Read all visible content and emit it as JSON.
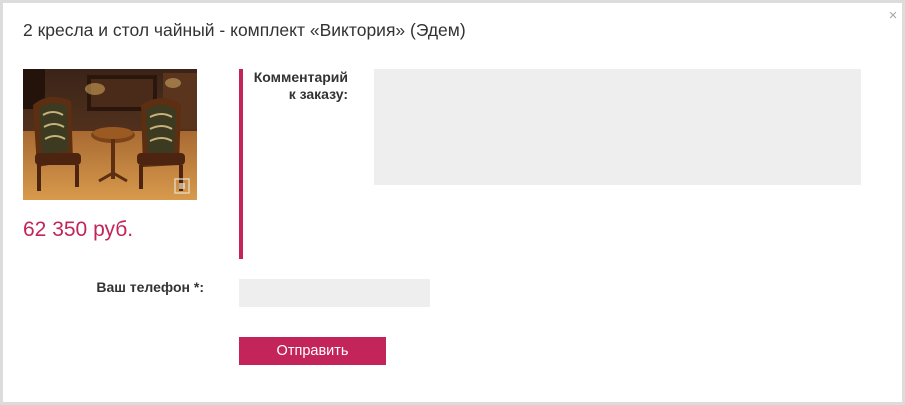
{
  "modal": {
    "title": "2 кресла и стол чайный - комплект «Виктория» (Эдем)",
    "close_symbol": "×",
    "close_icon": "close-icon"
  },
  "product": {
    "image": "product-photo-armchairs-and-tea-table",
    "price": "62 350 руб."
  },
  "form": {
    "comment_label_line1": "Комментарий",
    "comment_label_line2": "к заказу:",
    "comment_value": "",
    "phone_label": "Ваш телефон *:",
    "phone_value": "",
    "submit_label": "Отправить"
  },
  "colors": {
    "accent": "#c3245a",
    "field_background": "#eeeeee",
    "modal_border": "#dcdcdc"
  }
}
